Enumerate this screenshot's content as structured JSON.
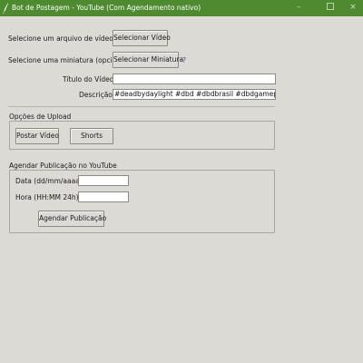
{
  "window": {
    "title": "Bot de Postagem - YouTube (Com Agendamento nativo)",
    "icon": "feather-pen-icon",
    "controls": {
      "minimize": "–",
      "maximize": "□",
      "close": "×"
    }
  },
  "video": {
    "label": "Selecione um arquivo de vídeo:",
    "button": "Selecionar Vídeo"
  },
  "thumbnail": {
    "label": "Selecione uma miniatura (opcional):",
    "button": "Selecionar Miniatura",
    "help": "?"
  },
  "title_field": {
    "label": "Título do Vídeo:",
    "value": ""
  },
  "description_field": {
    "label": "Descrição:",
    "value": "#deadbydaylight #dbd #dbdbrasil #dbdgameplay #dbdc"
  },
  "upload_options": {
    "title": "Opções de Upload",
    "post_video": "Postar Vídeo",
    "shorts": "Shorts"
  },
  "schedule": {
    "title": "Agendar Publicação no YouTube",
    "date_label": "Data (dd/mm/aaaa):",
    "date_value": "",
    "time_label": "Hora (HH:MM 24h):",
    "time_value": "",
    "button": "Agendar Publicação"
  },
  "colors": {
    "titlebar": "#4e8a2f",
    "background": "#dcdad5",
    "help": "#2a4fb0"
  }
}
